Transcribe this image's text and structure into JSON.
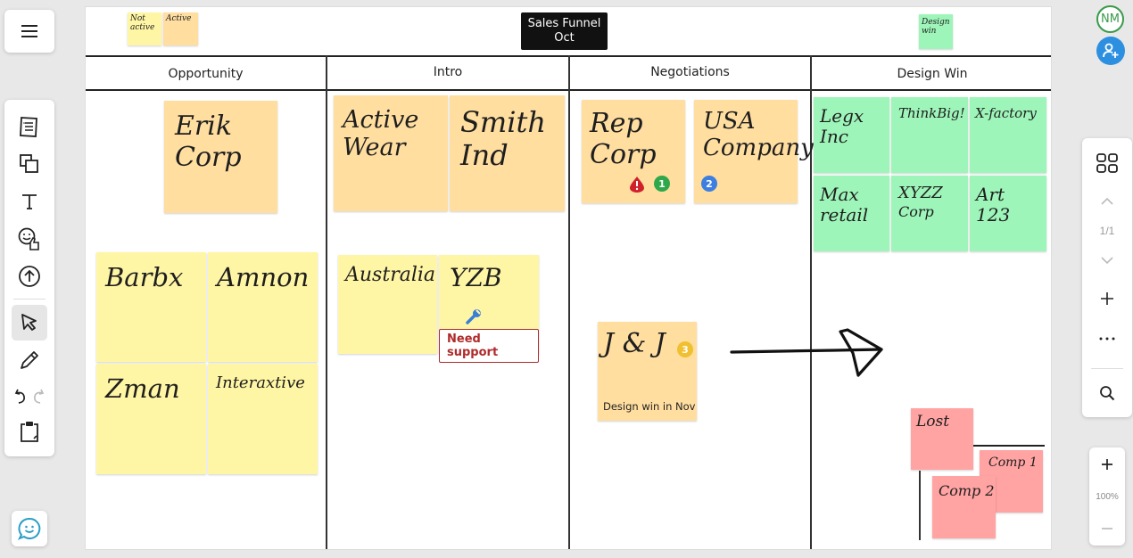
{
  "board": {
    "title_line1": "Sales Funnel",
    "title_line2": "Oct",
    "legend": [
      {
        "label_line1": "Not",
        "label_line2": "active",
        "color": "#fff6a5"
      },
      {
        "label_line1": "Active",
        "label_line2": "",
        "color": "#ffdea0"
      },
      {
        "label_line1": "Design",
        "label_line2": "win",
        "color": "#9ef5b9"
      }
    ],
    "columns": [
      {
        "header": "Opportunity"
      },
      {
        "header": "Intro"
      },
      {
        "header": "Negotiations"
      },
      {
        "header": "Design Win"
      }
    ],
    "stickies": {
      "erik_corp": {
        "line1": "Erik",
        "line2": "Corp"
      },
      "barbx": "Barbx",
      "amnon": "Amnon",
      "zman": "Zman",
      "interaxtive": "Interaxtive",
      "active_wear": {
        "line1": "Active",
        "line2": "Wear"
      },
      "smith_ind": {
        "line1": "Smith",
        "line2": "Ind"
      },
      "australia": "Australia",
      "yzb": {
        "text": "YZB",
        "tag": "Need support"
      },
      "rep_corp": {
        "line1": "Rep",
        "line2": "Corp",
        "badge": "1"
      },
      "usa_company": {
        "line1": "USA",
        "line2": "Company",
        "badge": "2"
      },
      "jnj": {
        "text": "J & J",
        "badge": "3",
        "note": "Design win in Nov"
      },
      "legx_inc": {
        "line1": "Legx",
        "line2": "Inc"
      },
      "thinkbig": "ThinkBig!",
      "x_factory": "X-factory",
      "max_retail": {
        "line1": "Max",
        "line2": "retail"
      },
      "xyzz_corp": {
        "line1": "XYZZ",
        "line2": "Corp"
      },
      "art_123": {
        "line1": "Art",
        "line2": "123"
      },
      "lost": "Lost",
      "comp1": "Comp 1",
      "comp2": "Comp 2"
    }
  },
  "colors": {
    "badge_green": "#2ea84a",
    "badge_blue": "#3d7fe0",
    "badge_yellow": "#f0c030",
    "badge_red": "#d0202a",
    "accent_blue": "#2d8fe0",
    "avatar_green": "#3a9b4a"
  },
  "user": {
    "initials": "NM"
  },
  "navigation": {
    "page_indicator": "1/1"
  },
  "zoom": {
    "level": "100%"
  }
}
